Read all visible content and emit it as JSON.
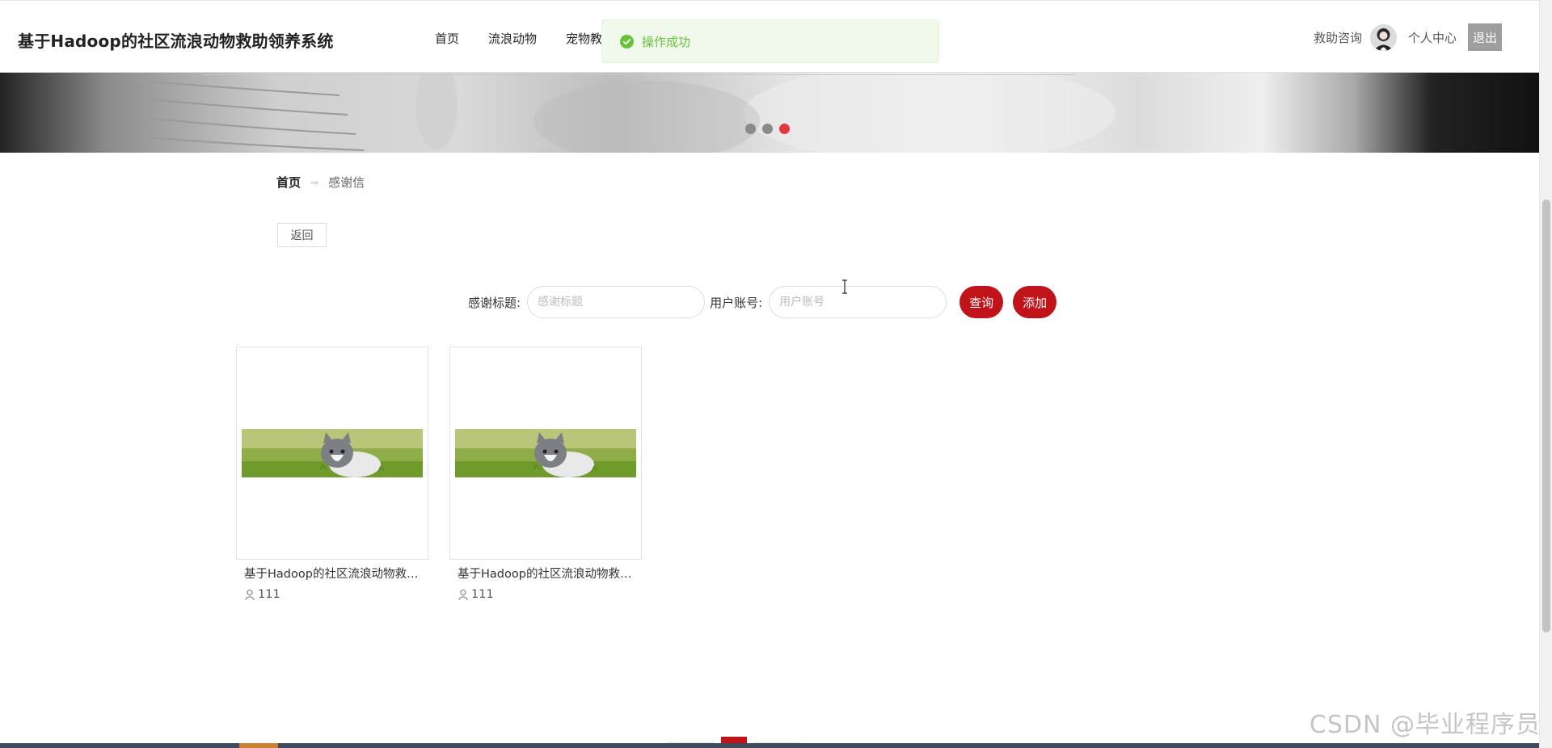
{
  "header": {
    "site_title": "基于Hadoop的社区流浪动物救助领养系统",
    "nav": [
      {
        "label": "首页"
      },
      {
        "label": "流浪动物"
      },
      {
        "label": "宠物教"
      }
    ],
    "consult_label": "救助咨询",
    "profile_label": "个人中心",
    "logout_label": "退出"
  },
  "toast": {
    "text": "操作成功",
    "color": "#67c23a"
  },
  "banner": {
    "slide_count": 3,
    "active_slide": 3,
    "active_color": "#e23a3a"
  },
  "breadcrumb": {
    "home": "首页",
    "separator": "⇒",
    "current": "感谢信"
  },
  "back_button": "返回",
  "search": {
    "title_label": "感谢标题:",
    "title_placeholder": "感谢标题",
    "account_label": "用户账号:",
    "account_placeholder": "用户账号",
    "query_label": "查询",
    "add_label": "添加",
    "accent_color": "#c0131a"
  },
  "cards": [
    {
      "title": "基于Hadoop的社区流浪动物救助领养系统",
      "author": "111"
    },
    {
      "title": "基于Hadoop的社区流浪动物救助领养系统",
      "author": "111"
    }
  ],
  "watermark": "CSDN @毕业程序员"
}
